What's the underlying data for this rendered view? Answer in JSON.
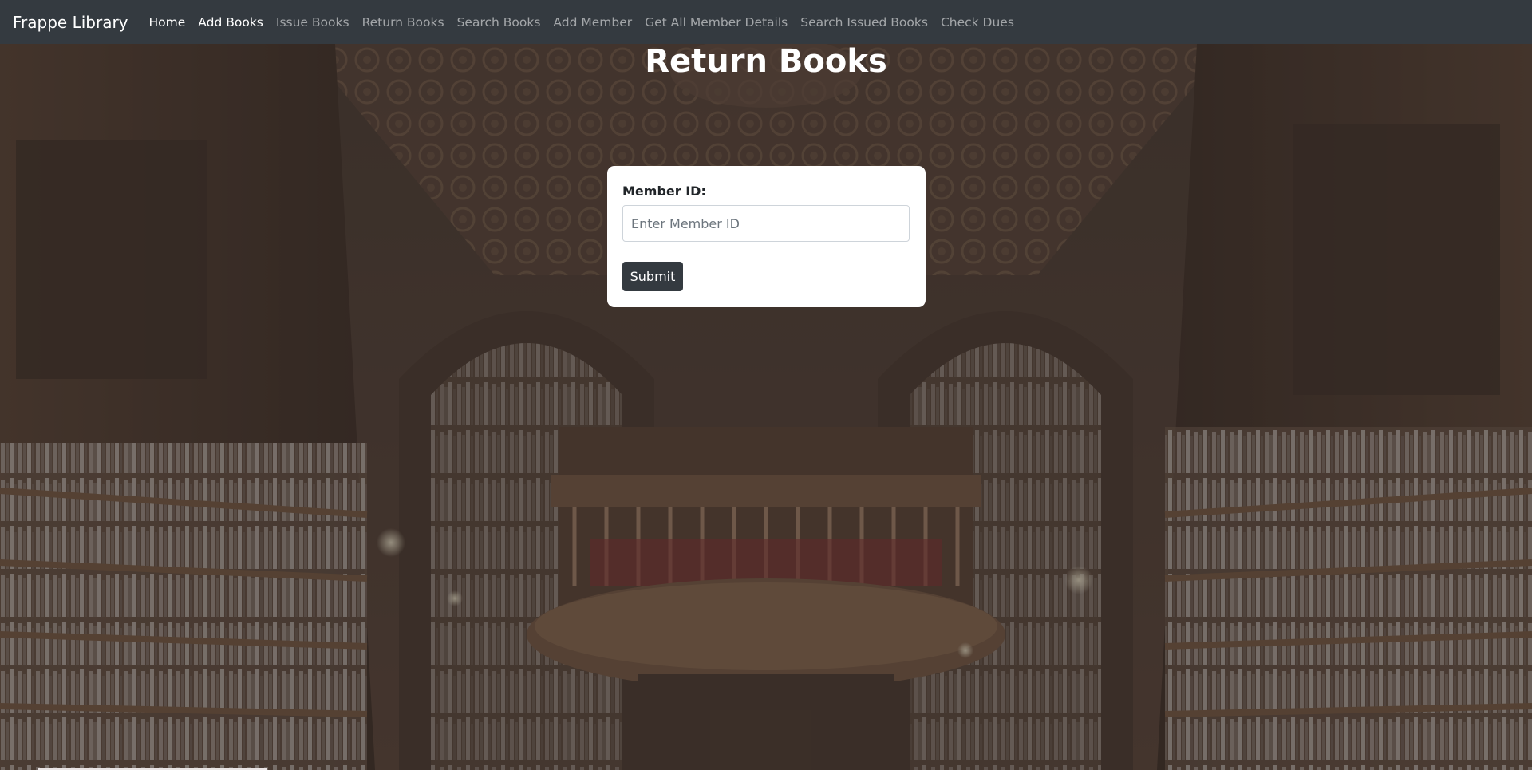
{
  "navbar": {
    "brand": "Frappe Library",
    "items": [
      {
        "label": "Home",
        "active": true
      },
      {
        "label": "Add Books",
        "active": true
      },
      {
        "label": "Issue Books",
        "active": false
      },
      {
        "label": "Return Books",
        "active": false
      },
      {
        "label": "Search Books",
        "active": false
      },
      {
        "label": "Add Member",
        "active": false
      },
      {
        "label": "Get All Member Details",
        "active": false
      },
      {
        "label": "Search Issued Books",
        "active": false
      },
      {
        "label": "Check Dues",
        "active": false
      }
    ]
  },
  "page": {
    "title": "Return Books"
  },
  "form": {
    "member_label": "Member ID:",
    "member_value": "",
    "member_placeholder": "Enter Member ID",
    "submit_label": "Submit"
  },
  "colors": {
    "navbar": "#343a40",
    "button": "#343a40",
    "card": "#ffffff"
  }
}
